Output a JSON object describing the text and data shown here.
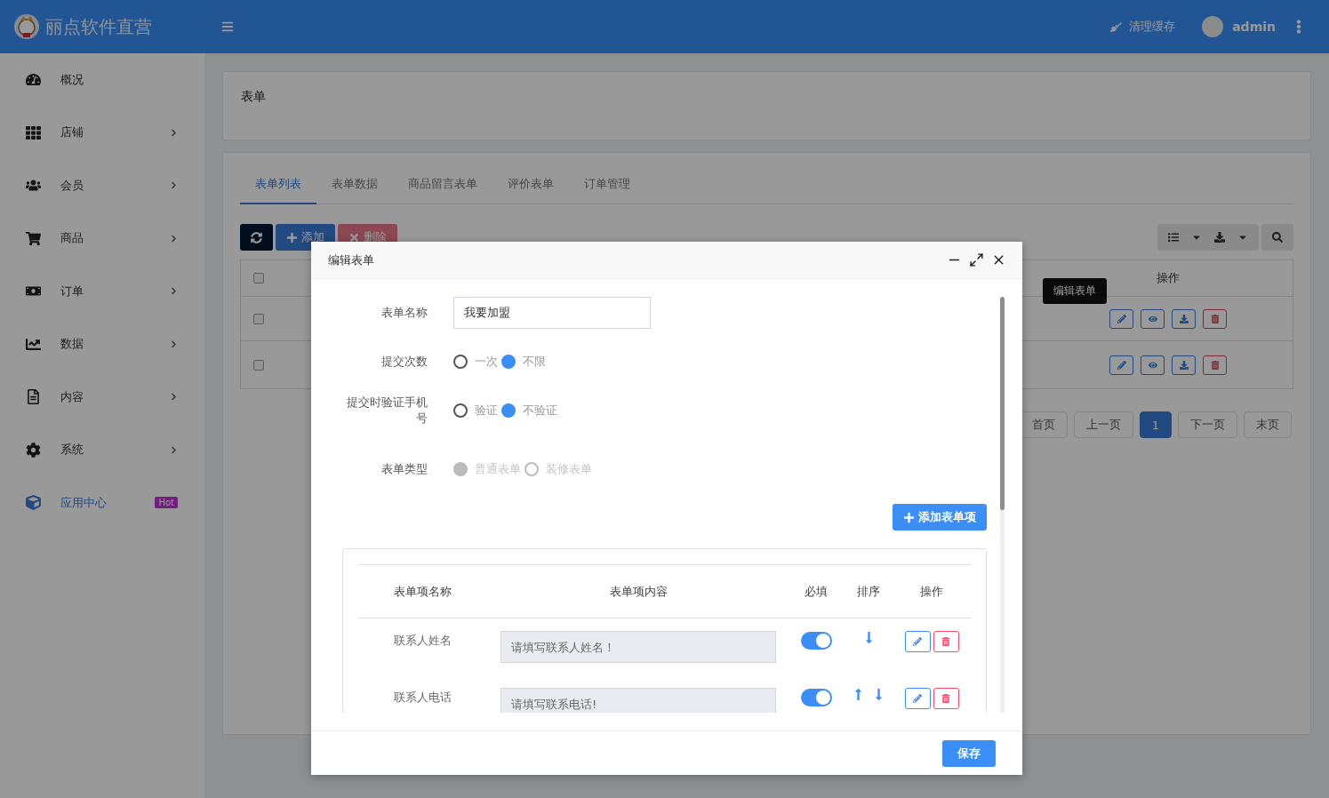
{
  "brand": {
    "name": "丽点软件直营"
  },
  "header": {
    "clear_cache": "清理缓存",
    "user": "admin"
  },
  "sidebar": {
    "items": [
      {
        "label": "概况",
        "has_children": false,
        "selected": false
      },
      {
        "label": "店铺",
        "has_children": true,
        "selected": false
      },
      {
        "label": "会员",
        "has_children": true,
        "selected": false
      },
      {
        "label": "商品",
        "has_children": true,
        "selected": false
      },
      {
        "label": "订单",
        "has_children": true,
        "selected": false
      },
      {
        "label": "数据",
        "has_children": true,
        "selected": false
      },
      {
        "label": "内容",
        "has_children": true,
        "selected": false
      },
      {
        "label": "系统",
        "has_children": true,
        "selected": false
      },
      {
        "label": "应用中心",
        "has_children": false,
        "selected": true,
        "badge": "Hot"
      }
    ]
  },
  "page_title": "表单",
  "tabs": [
    {
      "label": "表单列表",
      "selected": true
    },
    {
      "label": "表单数据",
      "selected": false
    },
    {
      "label": "商品留言表单",
      "selected": false
    },
    {
      "label": "评价表单",
      "selected": false
    },
    {
      "label": "订单管理",
      "selected": false
    }
  ],
  "toolbar": {
    "add": "添加",
    "delete": "删除",
    "delete_disabled": true
  },
  "table": {
    "header_checked": false,
    "columns": [
      "操作"
    ],
    "rows": [
      {
        "checked": false
      },
      {
        "checked": false
      }
    ]
  },
  "tooltip": "编辑表单",
  "pagination": [
    {
      "label": "首页",
      "selected": false
    },
    {
      "label": "上一页",
      "selected": false
    },
    {
      "label": "1",
      "selected": true
    },
    {
      "label": "下一页",
      "selected": false
    },
    {
      "label": "末页",
      "selected": false
    }
  ],
  "modal": {
    "title": "编辑表单",
    "fields": [
      {
        "kind": "text",
        "label": "表单名称",
        "value": "我要加盟"
      },
      {
        "kind": "radio",
        "label": "提交次数",
        "disabled": false,
        "options": [
          {
            "label": "一次",
            "selected": false
          },
          {
            "label": "不限",
            "selected": true
          }
        ]
      },
      {
        "kind": "radio",
        "label": "提交时验证手机号",
        "disabled": false,
        "options": [
          {
            "label": "验证",
            "selected": false
          },
          {
            "label": "不验证",
            "selected": true
          }
        ]
      },
      {
        "kind": "radio",
        "label": "表单类型",
        "disabled": true,
        "options": [
          {
            "label": "普通表单",
            "selected": true
          },
          {
            "label": "装修表单",
            "selected": false
          }
        ]
      }
    ],
    "add_item_button": "添加表单项",
    "items_table": {
      "columns": [
        "表单项名称",
        "表单项内容",
        "必填",
        "排序",
        "操作"
      ],
      "rows": [
        {
          "name": "联系人姓名",
          "placeholder": "请填写联系人姓名！",
          "required": true,
          "move_up": false,
          "move_down": true
        },
        {
          "name": "联系人电话",
          "placeholder": "请填写联系电话!",
          "required": true,
          "move_up": true,
          "move_down": true
        }
      ]
    },
    "save_button": "保存"
  }
}
